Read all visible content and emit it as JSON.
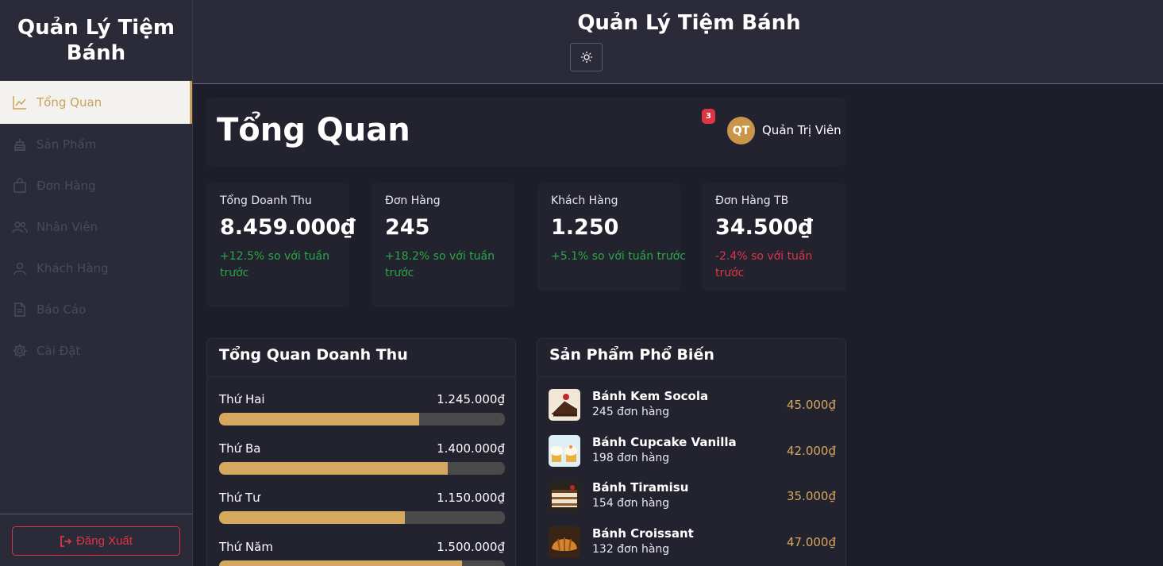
{
  "sidebar": {
    "brand": "Quản Lý Tiệm Bánh",
    "items": [
      {
        "label": "Tổng Quan",
        "icon": "chart-line-icon"
      },
      {
        "label": "Sản Phẩm",
        "icon": "cake-icon"
      },
      {
        "label": "Đơn Hàng",
        "icon": "shopping-bag-icon"
      },
      {
        "label": "Nhân Viên",
        "icon": "users-icon"
      },
      {
        "label": "Khách Hàng",
        "icon": "user-icon"
      },
      {
        "label": "Báo Cáo",
        "icon": "file-icon"
      },
      {
        "label": "Cài Đặt",
        "icon": "gear-icon"
      }
    ],
    "logout_label": "Đăng Xuất"
  },
  "topbar": {
    "title": "Quản Lý Tiệm Bánh",
    "theme_icon": "sun-icon"
  },
  "header": {
    "title": "Tổng Quan",
    "notifications": "3",
    "avatar_initials": "QT",
    "username": "Quản Trị Viên"
  },
  "stats": [
    {
      "label": "Tổng Doanh Thu",
      "value": "8.459.000₫",
      "change": "+12.5% so với tuần trước"
    },
    {
      "label": "Đơn Hàng",
      "value": "245",
      "change": "+18.2% so với tuần trước"
    },
    {
      "label": "Khách Hàng",
      "value": "1.250",
      "change": "+5.1% so với tuần trước"
    },
    {
      "label": "Đơn Hàng TB",
      "value": "34.500₫",
      "change": "-2.4% so với tuần trước"
    }
  ],
  "revenue": {
    "title": "Tổng Quan Doanh Thu",
    "rows": [
      {
        "day": "Thứ Hai",
        "amount": "1.245.000₫",
        "percent": 70
      },
      {
        "day": "Thứ Ba",
        "amount": "1.400.000₫",
        "percent": 80
      },
      {
        "day": "Thứ Tư",
        "amount": "1.150.000₫",
        "percent": 65
      },
      {
        "day": "Thứ Năm",
        "amount": "1.500.000₫",
        "percent": 85
      }
    ]
  },
  "popular": {
    "title": "Sản Phẩm Phổ Biến",
    "items": [
      {
        "name": "Bánh Kem Socola",
        "orders": "245 đơn hàng",
        "price": "45.000₫"
      },
      {
        "name": "Bánh Cupcake Vanilla",
        "orders": "198 đơn hàng",
        "price": "42.000₫"
      },
      {
        "name": "Bánh Tiramisu",
        "orders": "154 đơn hàng",
        "price": "35.000₫"
      },
      {
        "name": "Bánh Croissant",
        "orders": "132 đơn hàng",
        "price": "47.000₫"
      }
    ]
  },
  "colors": {
    "accent": "#d4a85e",
    "positive": "#28a745",
    "negative": "#dc3545",
    "background": "#1e1e2a",
    "panel": "#2a2a38"
  }
}
